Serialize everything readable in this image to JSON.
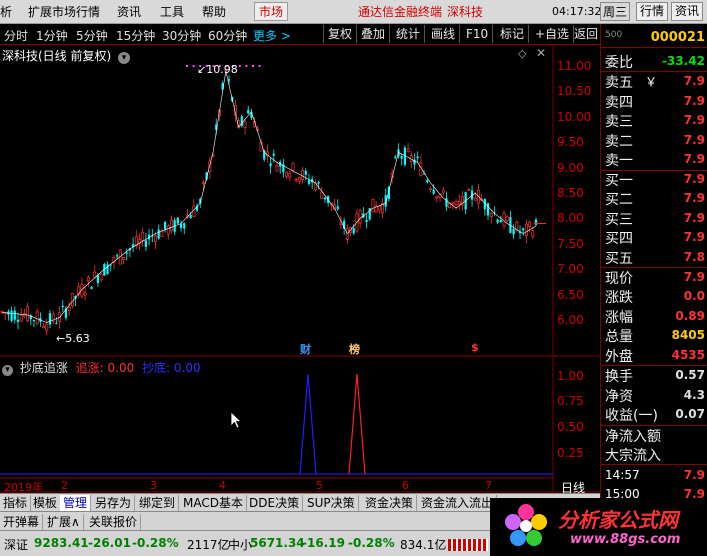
{
  "menubar": {
    "items": [
      "析",
      "扩展市场行情",
      "资讯",
      "工具",
      "帮助"
    ],
    "active_item": "市场",
    "title": "通达信金融终端",
    "stock": "深科技",
    "clock": "04:17:32",
    "day": "周三",
    "btn_quote": "行情",
    "btn_info": "资讯"
  },
  "periodbar": {
    "periods": [
      "分时",
      "1分钟",
      "5分钟",
      "15分钟",
      "30分钟",
      "60分钟"
    ],
    "more": "更多 >",
    "tools": [
      "复权",
      "叠加",
      "统计",
      "画线",
      "F10",
      "标记",
      "+自选",
      "返回"
    ]
  },
  "chart": {
    "header": "深科技(日线 前复权)",
    "high_label": "10.98",
    "low_label": "5.63",
    "events": [
      "财",
      "榜",
      "$"
    ],
    "chart_data": {
      "type": "candlestick",
      "yticks": [
        "11.00",
        "10.50",
        "10.00",
        "9.50",
        "9.00",
        "8.50",
        "8.00",
        "7.50",
        "7.00",
        "6.50",
        "6.00"
      ],
      "ylim": [
        5.5,
        11.2
      ],
      "x_labels": [
        "2019年",
        "2",
        "3",
        "4",
        "5",
        "6",
        "7"
      ],
      "high": 10.98,
      "low": 5.63,
      "colors": {
        "up": "#ff3232",
        "down": "#00ffff",
        "ma": "#ffffff"
      }
    }
  },
  "indicator": {
    "name": "抄底追涨",
    "line1": "追涨: 0.00",
    "line2": "抄底: 0.00",
    "yticks": [
      "1.00",
      "0.75",
      "0.50",
      "0.25"
    ],
    "chart_data": {
      "type": "line",
      "series": [
        {
          "name": "追涨",
          "color": "#ff2020",
          "spike_at_label": "5"
        },
        {
          "name": "抄底",
          "color": "#2020ff",
          "spike_at_label": "4"
        }
      ],
      "ylim": [
        0,
        1
      ]
    },
    "period_label": "日线"
  },
  "rightpanel": {
    "top_number": "000021",
    "sub_small": "500",
    "weibi_label": "委比",
    "weibi_value": "-33.42",
    "sell": [
      {
        "label": "卖五",
        "value": "7.9",
        "unit": "￥"
      },
      {
        "label": "卖四",
        "value": "7.9"
      },
      {
        "label": "卖三",
        "value": "7.9"
      },
      {
        "label": "卖二",
        "value": "7.9"
      },
      {
        "label": "卖一",
        "value": "7.9"
      }
    ],
    "buy": [
      {
        "label": "买一",
        "value": "7.9"
      },
      {
        "label": "买二",
        "value": "7.9"
      },
      {
        "label": "买三",
        "value": "7.9"
      },
      {
        "label": "买四",
        "value": "7.9"
      },
      {
        "label": "买五",
        "value": "7.8"
      }
    ],
    "stats": [
      {
        "label": "现价",
        "value": "7.9"
      },
      {
        "label": "涨跌",
        "value": "0.0"
      },
      {
        "label": "涨幅",
        "value": "0.89"
      },
      {
        "label": "总量",
        "value": "8405"
      },
      {
        "label": "外盘",
        "value": "4535"
      }
    ],
    "stats2": [
      {
        "label": "换手",
        "value": "0.57"
      },
      {
        "label": "净资",
        "value": "4.3"
      },
      {
        "label": "收益(一)",
        "value": "0.07"
      }
    ],
    "flow": [
      "净流入额",
      "大宗流入"
    ],
    "ticks": [
      {
        "time": "14:57",
        "price": "7.9"
      },
      {
        "time": "15:00",
        "price": "7.9"
      }
    ]
  },
  "tabs": [
    "指标",
    "模板",
    "管理",
    "另存为",
    "绑定到",
    "MACD基本",
    "DDE决策",
    "SUP决策",
    "资金决策",
    "资金流入流出"
  ],
  "selected_tab": "管理",
  "tabs2": [
    "开弹幕",
    "扩展∧",
    "关联报价"
  ],
  "status": {
    "sz_name": "深证",
    "sz_value": "9283.41",
    "sz_change": "-26.01",
    "sz_pct": "-0.28%",
    "sz_amount": "2117亿",
    "zx_name": "中小",
    "zx_value": "5671.34",
    "zx_change": "-16.19",
    "zx_pct": "-0.28%",
    "zx_amount": "834.1亿"
  },
  "watermark": {
    "brand": "分析家公式网",
    "url": "www.88gs.com"
  }
}
